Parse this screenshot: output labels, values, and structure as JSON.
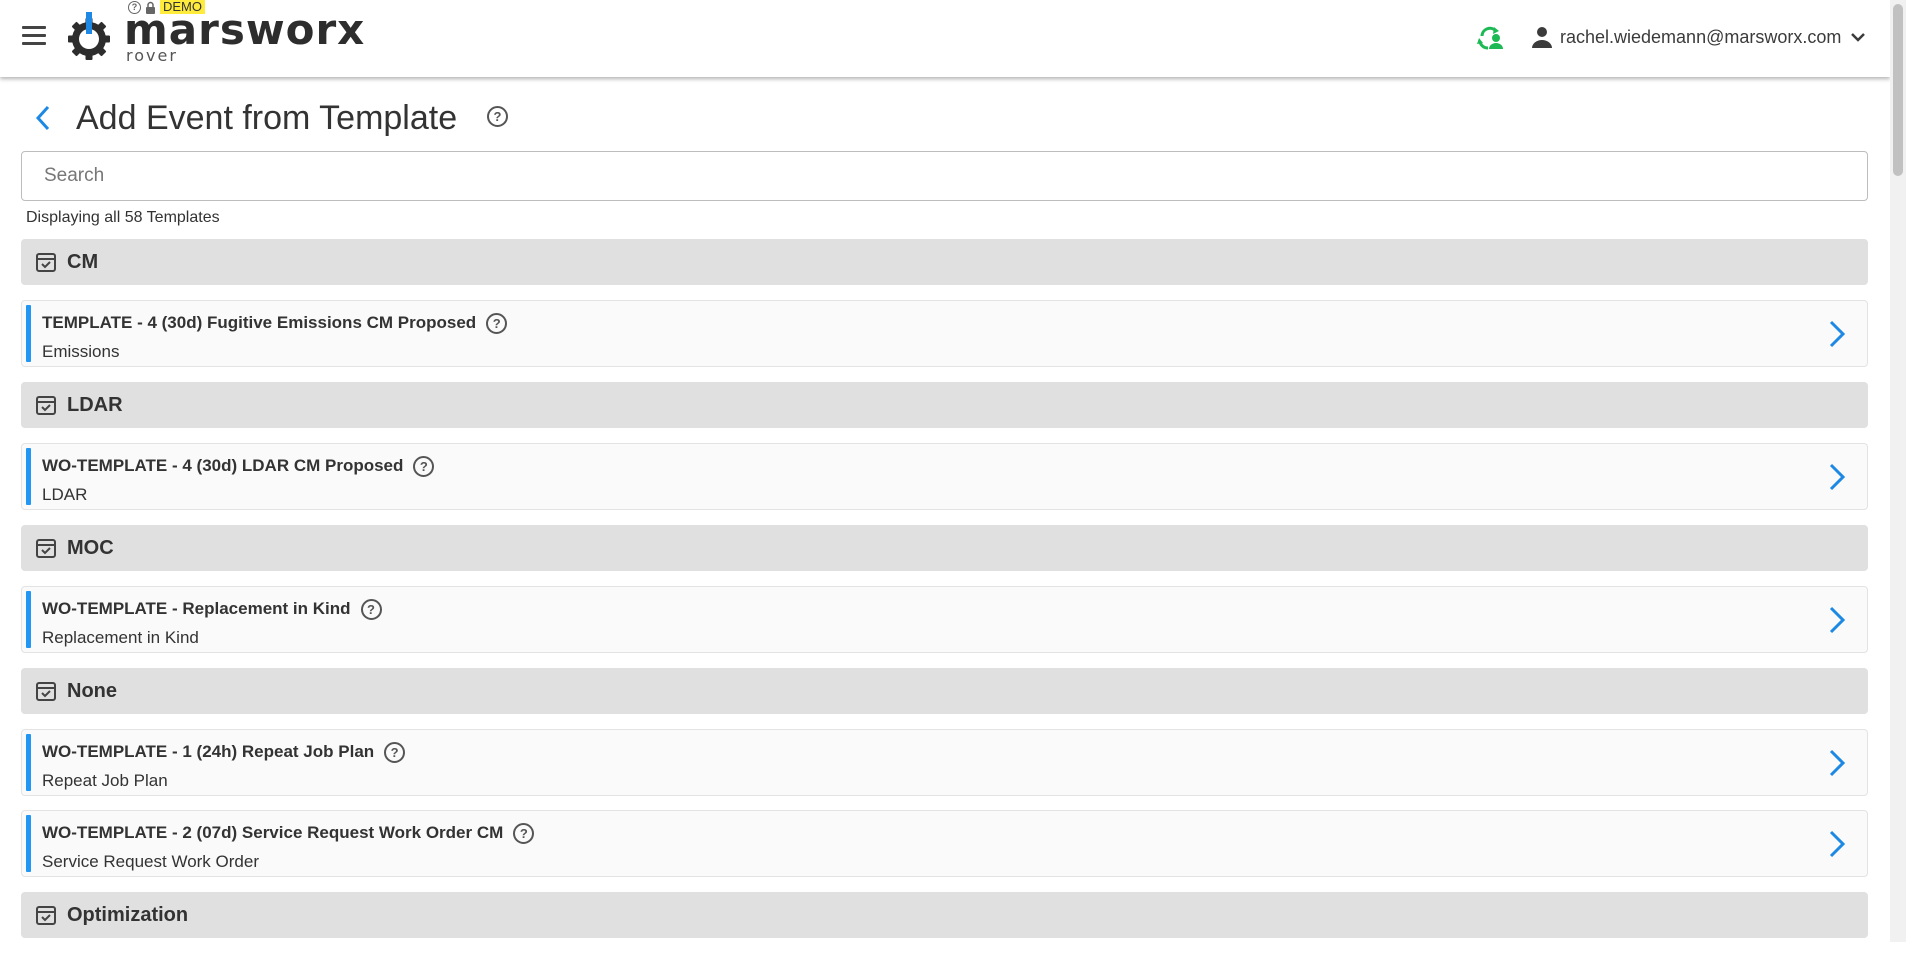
{
  "app": {
    "logo_text": "marsworx",
    "logo_sub": "rover",
    "demo_badge": "DEMO",
    "user_email": "rachel.wiedemann@marsworx.com"
  },
  "page": {
    "title": "Add Event from Template"
  },
  "search": {
    "placeholder": "Search",
    "value": ""
  },
  "count_text": "Displaying all 58 Templates",
  "colors": {
    "accent": "#2196f3",
    "sync_green": "#1db954",
    "group_bg": "#e0e0e0"
  },
  "groups": [
    {
      "label": "CM",
      "items": [
        {
          "title": "TEMPLATE - 4 (30d) Fugitive Emissions CM Proposed",
          "subtitle": "Emissions"
        }
      ]
    },
    {
      "label": "LDAR",
      "items": [
        {
          "title": "WO-TEMPLATE - 4 (30d) LDAR CM Proposed",
          "subtitle": "LDAR"
        }
      ]
    },
    {
      "label": "MOC",
      "items": [
        {
          "title": "WO-TEMPLATE - Replacement in Kind",
          "subtitle": "Replacement in Kind"
        }
      ]
    },
    {
      "label": "None",
      "items": [
        {
          "title": "WO-TEMPLATE - 1 (24h) Repeat Job Plan",
          "subtitle": "Repeat Job Plan"
        },
        {
          "title": "WO-TEMPLATE - 2 (07d) Service Request Work Order CM",
          "subtitle": "Service Request Work Order"
        }
      ]
    },
    {
      "label": "Optimization",
      "items": []
    }
  ],
  "icons": {
    "menu": "hamburger-menu-icon",
    "back": "chevron-left-icon",
    "help": "help-circle-icon",
    "sync": "sync-icon",
    "user": "account-icon",
    "dropdown": "chevron-down-icon",
    "group": "calendar-check-icon",
    "row_open": "chevron-right-icon"
  }
}
